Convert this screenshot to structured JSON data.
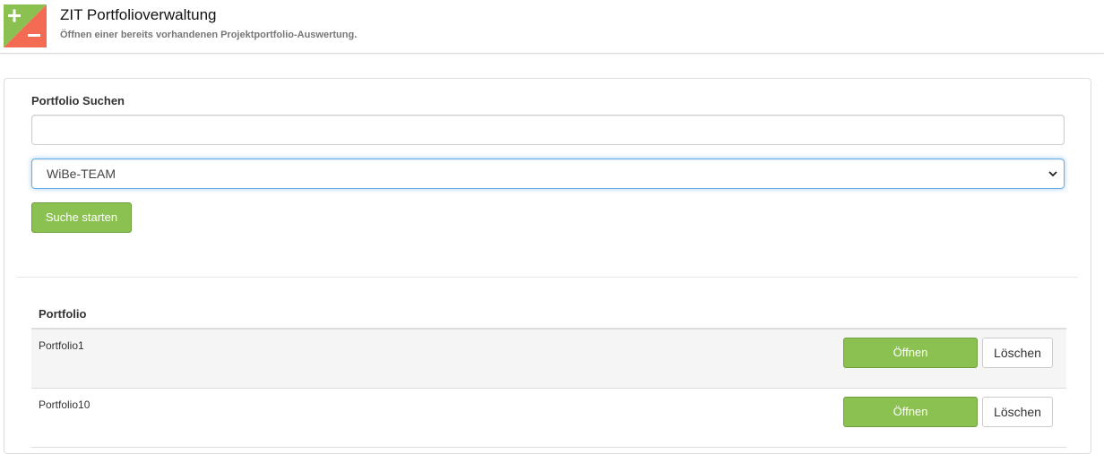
{
  "header": {
    "title": "ZIT Portfolioverwaltung",
    "subtitle": "Öffnen einer bereits vorhandenen Projektportfolio-Auswertung.",
    "logo_colors": {
      "green": "#8bc150",
      "red": "#f26b52"
    }
  },
  "search": {
    "label": "Portfolio Suchen",
    "input_value": "",
    "input_placeholder": "",
    "team_select_value": "WiBe-TEAM",
    "button_label": "Suche starten"
  },
  "table": {
    "column_header": "Portfolio",
    "rows": [
      {
        "name": "Portfolio1",
        "open_label": "Öffnen",
        "delete_label": "Löschen"
      },
      {
        "name": "Portfolio10",
        "open_label": "Öffnen",
        "delete_label": "Löschen"
      }
    ]
  },
  "colors": {
    "accent_green": "#8bc150",
    "focus_blue": "#66afe9"
  }
}
